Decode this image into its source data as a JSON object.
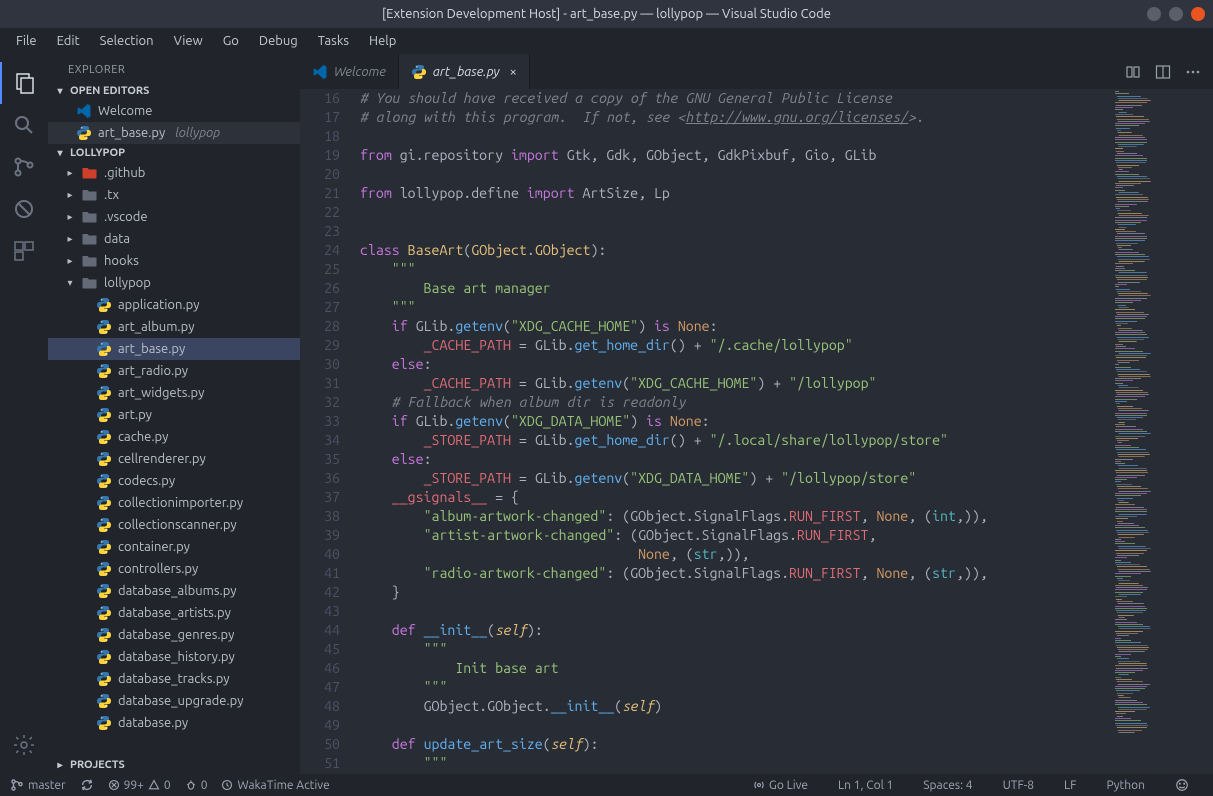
{
  "window": {
    "title": "[Extension Development Host] - art_base.py — lollypop — Visual Studio Code"
  },
  "menubar": [
    "File",
    "Edit",
    "Selection",
    "View",
    "Go",
    "Debug",
    "Tasks",
    "Help"
  ],
  "sidebar": {
    "title": "EXPLORER",
    "sections": {
      "openEditors": "OPEN EDITORS",
      "project": "LOLLYPOP",
      "projects": "PROJECTS"
    },
    "openEditors": [
      {
        "icon": "vscode",
        "label": "Welcome"
      },
      {
        "icon": "py",
        "label": "art_base.py",
        "desc": "lollypop"
      }
    ],
    "tree": [
      {
        "depth": 0,
        "type": "folder",
        "label": ".github",
        "collapsed": true,
        "special": "git"
      },
      {
        "depth": 0,
        "type": "folder",
        "label": ".tx",
        "collapsed": true
      },
      {
        "depth": 0,
        "type": "folder",
        "label": ".vscode",
        "collapsed": true
      },
      {
        "depth": 0,
        "type": "folder",
        "label": "data",
        "collapsed": true
      },
      {
        "depth": 0,
        "type": "folder",
        "label": "hooks",
        "collapsed": true
      },
      {
        "depth": 0,
        "type": "folder",
        "label": "lollypop",
        "collapsed": false
      },
      {
        "depth": 1,
        "type": "py",
        "label": "application.py"
      },
      {
        "depth": 1,
        "type": "py",
        "label": "art_album.py"
      },
      {
        "depth": 1,
        "type": "py",
        "label": "art_base.py",
        "active": true
      },
      {
        "depth": 1,
        "type": "py",
        "label": "art_radio.py"
      },
      {
        "depth": 1,
        "type": "py",
        "label": "art_widgets.py"
      },
      {
        "depth": 1,
        "type": "py",
        "label": "art.py"
      },
      {
        "depth": 1,
        "type": "py",
        "label": "cache.py"
      },
      {
        "depth": 1,
        "type": "py",
        "label": "cellrenderer.py"
      },
      {
        "depth": 1,
        "type": "py",
        "label": "codecs.py"
      },
      {
        "depth": 1,
        "type": "py",
        "label": "collectionimporter.py"
      },
      {
        "depth": 1,
        "type": "py",
        "label": "collectionscanner.py"
      },
      {
        "depth": 1,
        "type": "py",
        "label": "container.py"
      },
      {
        "depth": 1,
        "type": "py",
        "label": "controllers.py"
      },
      {
        "depth": 1,
        "type": "py",
        "label": "database_albums.py"
      },
      {
        "depth": 1,
        "type": "py",
        "label": "database_artists.py"
      },
      {
        "depth": 1,
        "type": "py",
        "label": "database_genres.py"
      },
      {
        "depth": 1,
        "type": "py",
        "label": "database_history.py"
      },
      {
        "depth": 1,
        "type": "py",
        "label": "database_tracks.py"
      },
      {
        "depth": 1,
        "type": "py",
        "label": "database_upgrade.py"
      },
      {
        "depth": 1,
        "type": "py",
        "label": "database.py"
      }
    ]
  },
  "tabs": [
    {
      "icon": "vscode",
      "label": "Welcome",
      "active": false
    },
    {
      "icon": "py",
      "label": "art_base.py",
      "active": true,
      "closable": true
    }
  ],
  "code": {
    "startLine": 16,
    "lines": [
      {
        "n": 16,
        "t": "cmt",
        "text": "# You should have received a copy of the GNU General Public License"
      },
      {
        "n": 17,
        "t": "cmt-url",
        "text": "# along with this program.  If not, see <",
        "url": "http://www.gnu.org/licenses/",
        "after": ">."
      },
      {
        "n": 18,
        "t": "blank"
      },
      {
        "n": 19,
        "t": "import1"
      },
      {
        "n": 20,
        "t": "blank"
      },
      {
        "n": 21,
        "t": "import2"
      },
      {
        "n": 22,
        "t": "blank"
      },
      {
        "n": 23,
        "t": "blank"
      },
      {
        "n": 24,
        "t": "classdef"
      },
      {
        "n": 25,
        "t": "docq",
        "indent": 4
      },
      {
        "n": 26,
        "t": "doc",
        "text": "Base art manager",
        "indent": 8
      },
      {
        "n": 27,
        "t": "docq",
        "indent": 4
      },
      {
        "n": 28,
        "t": "ifcache"
      },
      {
        "n": 29,
        "t": "cacheassign1"
      },
      {
        "n": 30,
        "t": "else"
      },
      {
        "n": 31,
        "t": "cacheassign2"
      },
      {
        "n": 32,
        "t": "cmt",
        "text": "    # Fallback when album dir is readonly"
      },
      {
        "n": 33,
        "t": "ifdata"
      },
      {
        "n": 34,
        "t": "storeassign1"
      },
      {
        "n": 35,
        "t": "else"
      },
      {
        "n": 36,
        "t": "storeassign2"
      },
      {
        "n": 37,
        "t": "gsignals"
      },
      {
        "n": 38,
        "t": "sig",
        "key": "album-artwork-changed",
        "tail1": true
      },
      {
        "n": 39,
        "t": "sig2a",
        "key": "artist-artwork-changed"
      },
      {
        "n": 40,
        "t": "sig2b"
      },
      {
        "n": 41,
        "t": "sig",
        "key": "radio-artwork-changed",
        "tail2": true
      },
      {
        "n": 42,
        "t": "closebrace"
      },
      {
        "n": 43,
        "t": "blank"
      },
      {
        "n": 44,
        "t": "definit"
      },
      {
        "n": 45,
        "t": "docq",
        "indent": 8
      },
      {
        "n": 46,
        "t": "doc",
        "text": "Init base art",
        "indent": 12
      },
      {
        "n": 47,
        "t": "docq",
        "indent": 8
      },
      {
        "n": 48,
        "t": "superinit"
      },
      {
        "n": 49,
        "t": "blank"
      },
      {
        "n": 50,
        "t": "defupdate"
      },
      {
        "n": 51,
        "t": "docq",
        "indent": 8
      }
    ]
  },
  "statusbar": {
    "branch": "master",
    "sync": "",
    "errors": "99+",
    "warnings": "0",
    "debug": "0",
    "wakatime": "WakaTime Active",
    "golive": "Go Live",
    "cursor": "Ln 1, Col 1",
    "spaces": "Spaces: 4",
    "encoding": "UTF-8",
    "eol": "LF",
    "lang": "Python"
  }
}
